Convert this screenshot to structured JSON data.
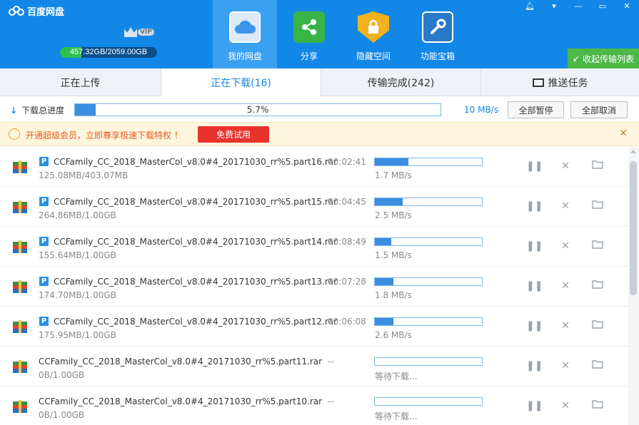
{
  "app": {
    "title": "百度网盘",
    "vip_label": "VIP",
    "storage_used": "457",
    "storage_rest": ".32GB/2059.00GB",
    "storage_fraction": 0.22
  },
  "nav": [
    {
      "label": "我的网盘",
      "icon": "cloud-icon",
      "color": "#ffffff"
    },
    {
      "label": "分享",
      "icon": "share-icon",
      "color": "#38b449"
    },
    {
      "label": "隐藏空间",
      "icon": "lock-shield-icon",
      "color": "#f2b21c"
    },
    {
      "label": "功能宝箱",
      "icon": "wrench-icon",
      "color": "#2a78c8"
    }
  ],
  "window_controls": [
    "bell",
    "menu",
    "minimize",
    "maximize",
    "close"
  ],
  "collapse_label": "收起传输列表",
  "tabs": [
    {
      "label": "正在上传",
      "active": false
    },
    {
      "label": "正在下载(16)",
      "active": true
    },
    {
      "label": "传输完成(242)",
      "active": false
    },
    {
      "label": "推送任务",
      "active": false,
      "icon": "screen-push-icon"
    }
  ],
  "progress": {
    "label": "下载总进度",
    "percent_text": "5.7%",
    "fraction": 0.057,
    "speed": "10 MB/s",
    "pause_all": "全部暂停",
    "cancel_all": "全部取消"
  },
  "promo": {
    "text": "开通超级会员，立即尊享极速下载特权 ！",
    "button": "免费试用"
  },
  "colors": {
    "accent": "#1387e6",
    "promo_button": "#e8322e",
    "collapse_button": "#4cb848"
  },
  "downloads": [
    {
      "name": "CCFamily_CC_2018_MasterCol_v8.0#4_20171030_rr%5.part16.rar",
      "size": "125.08MB/403.07MB",
      "time": "00:02:41",
      "speed": "1.7 MB/s",
      "progress": 0.31,
      "active": true
    },
    {
      "name": "CCFamily_CC_2018_MasterCol_v8.0#4_20171030_rr%5.part15.rar",
      "size": "264.86MB/1.00GB",
      "time": "00:04:45",
      "speed": "2.5 MB/s",
      "progress": 0.26,
      "active": true
    },
    {
      "name": "CCFamily_CC_2018_MasterCol_v8.0#4_20171030_rr%5.part14.rar",
      "size": "155.64MB/1.00GB",
      "time": "00:08:49",
      "speed": "1.5 MB/s",
      "progress": 0.15,
      "active": true
    },
    {
      "name": "CCFamily_CC_2018_MasterCol_v8.0#4_20171030_rr%5.part13.rar",
      "size": "174.70MB/1.00GB",
      "time": "00:07:28",
      "speed": "1.8 MB/s",
      "progress": 0.17,
      "active": true
    },
    {
      "name": "CCFamily_CC_2018_MasterCol_v8.0#4_20171030_rr%5.part12.rar",
      "size": "175.95MB/1.00GB",
      "time": "00:06:08",
      "speed": "2.6 MB/s",
      "progress": 0.17,
      "active": true
    },
    {
      "name": "CCFamily_CC_2018_MasterCol_v8.0#4_20171030_rr%5.part11.rar",
      "size": "0B/1.00GB",
      "time": "--",
      "speed": "等待下载...",
      "progress": 0,
      "active": false
    },
    {
      "name": "CCFamily_CC_2018_MasterCol_v8.0#4_20171030_rr%5.part10.rar",
      "size": "0B/1.00GB",
      "time": "--",
      "speed": "等待下载...",
      "progress": 0,
      "active": false
    }
  ]
}
